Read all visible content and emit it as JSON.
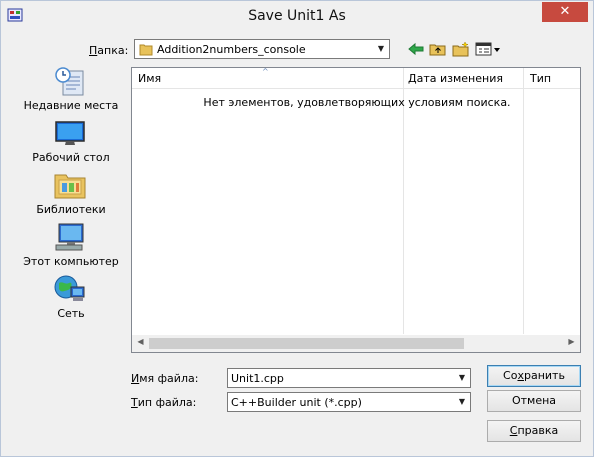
{
  "window": {
    "title": "Save Unit1 As",
    "close_label": "✕"
  },
  "folder": {
    "label_prefix": "П",
    "label_rest": "апка:",
    "value": "Addition2numbers_console"
  },
  "toolbar": {
    "icons": [
      "back-arrow-icon",
      "up-folder-icon",
      "new-folder-icon",
      "view-menu-icon"
    ]
  },
  "places": [
    {
      "label": "Недавние места",
      "icon": "recent-places-icon"
    },
    {
      "label": "Рабочий стол",
      "icon": "desktop-icon"
    },
    {
      "label": "Библиотеки",
      "icon": "libraries-icon"
    },
    {
      "label": "Этот компьютер",
      "icon": "computer-icon"
    },
    {
      "label": "Сеть",
      "icon": "network-icon"
    }
  ],
  "list": {
    "columns": [
      "Имя",
      "Дата изменения",
      "Тип"
    ],
    "empty_message": "Нет элементов, удовлетворяющих условиям поиска."
  },
  "filename": {
    "label_prefix": "И",
    "label_rest": "мя файла:",
    "value": "Unit1.cpp"
  },
  "filetype": {
    "label_prefix": "Т",
    "label_rest": "ип файла:",
    "value": "C++Builder unit (*.cpp)"
  },
  "buttons": {
    "save_prefix": "Со",
    "save_u": "х",
    "save_rest": "ранить",
    "cancel": "Отмена",
    "help_u": "С",
    "help_rest": "правка"
  }
}
